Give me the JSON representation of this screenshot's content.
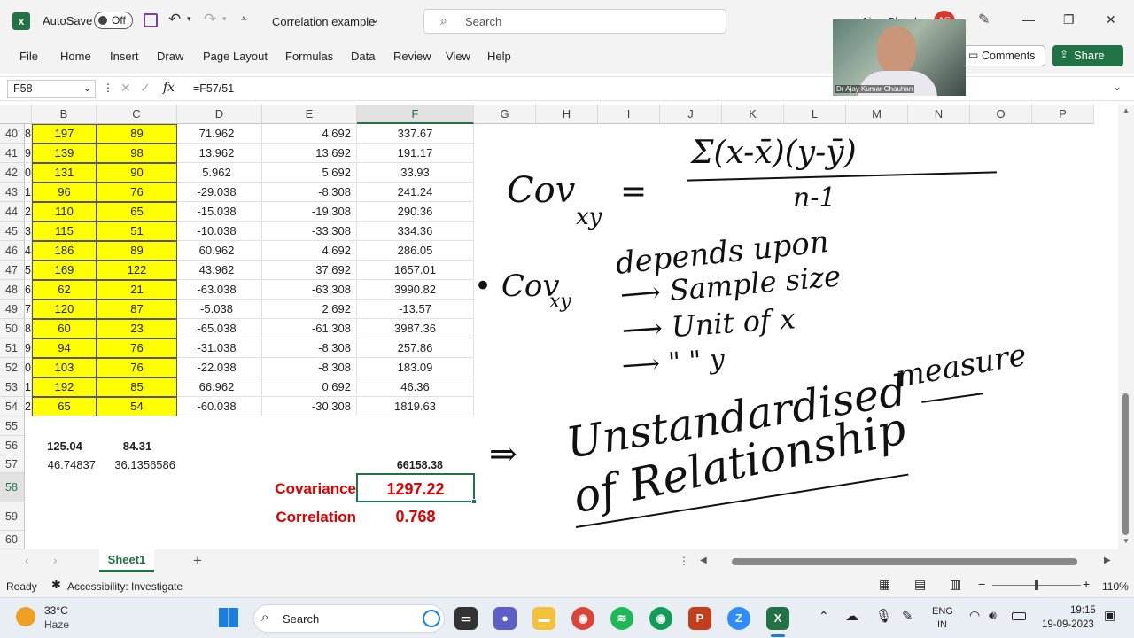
{
  "titlebar": {
    "autosave": "AutoSave",
    "toggle": "Off",
    "doc_title": "Correlation example",
    "search": "Search",
    "user": "Ajay Chauhan",
    "initials": "AC"
  },
  "menu": [
    "File",
    "Home",
    "Insert",
    "Draw",
    "Page Layout",
    "Formulas",
    "Data",
    "Review",
    "View",
    "Help"
  ],
  "buttons": {
    "comments": "Comments",
    "share": "Share"
  },
  "formula_bar": {
    "name_box": "F58",
    "fx": "fx",
    "formula": "=F57/51"
  },
  "webcam": {
    "caption": "Dr Ajay Kumar Chauhan"
  },
  "columns": [
    "B",
    "C",
    "D",
    "E",
    "F",
    "G",
    "H",
    "I",
    "J",
    "K",
    "L",
    "M",
    "N",
    "O",
    "P"
  ],
  "rows": [
    {
      "n": "40",
      "a": "8",
      "b": "197",
      "c": "89",
      "d": "71.962",
      "e": "4.692",
      "f": "337.67"
    },
    {
      "n": "41",
      "a": "9",
      "b": "139",
      "c": "98",
      "d": "13.962",
      "e": "13.692",
      "f": "191.17"
    },
    {
      "n": "42",
      "a": "0",
      "b": "131",
      "c": "90",
      "d": "5.962",
      "e": "5.692",
      "f": "33.93"
    },
    {
      "n": "43",
      "a": "1",
      "b": "96",
      "c": "76",
      "d": "-29.038",
      "e": "-8.308",
      "f": "241.24"
    },
    {
      "n": "44",
      "a": "2",
      "b": "110",
      "c": "65",
      "d": "-15.038",
      "e": "-19.308",
      "f": "290.36"
    },
    {
      "n": "45",
      "a": "3",
      "b": "115",
      "c": "51",
      "d": "-10.038",
      "e": "-33.308",
      "f": "334.36"
    },
    {
      "n": "46",
      "a": "4",
      "b": "186",
      "c": "89",
      "d": "60.962",
      "e": "4.692",
      "f": "286.05"
    },
    {
      "n": "47",
      "a": "5",
      "b": "169",
      "c": "122",
      "d": "43.962",
      "e": "37.692",
      "f": "1657.01"
    },
    {
      "n": "48",
      "a": "6",
      "b": "62",
      "c": "21",
      "d": "-63.038",
      "e": "-63.308",
      "f": "3990.82"
    },
    {
      "n": "49",
      "a": "7",
      "b": "120",
      "c": "87",
      "d": "-5.038",
      "e": "2.692",
      "f": "-13.57"
    },
    {
      "n": "50",
      "a": "8",
      "b": "60",
      "c": "23",
      "d": "-65.038",
      "e": "-61.308",
      "f": "3987.36"
    },
    {
      "n": "51",
      "a": "9",
      "b": "94",
      "c": "76",
      "d": "-31.038",
      "e": "-8.308",
      "f": "257.86"
    },
    {
      "n": "52",
      "a": "0",
      "b": "103",
      "c": "76",
      "d": "-22.038",
      "e": "-8.308",
      "f": "183.09"
    },
    {
      "n": "53",
      "a": "1",
      "b": "192",
      "c": "85",
      "d": "66.962",
      "e": "0.692",
      "f": "46.36"
    },
    {
      "n": "54",
      "a": "2",
      "b": "65",
      "c": "54",
      "d": "-60.038",
      "e": "-30.308",
      "f": "1819.63"
    }
  ],
  "extra_rows": {
    "r55": "55",
    "r56": "56",
    "r57": "57",
    "r58": "58",
    "r59": "59",
    "r60": "60"
  },
  "summary": {
    "mean_b": "125.04",
    "mean_c": "84.31",
    "sd_b": "46.74837",
    "sd_c": "36.1356586",
    "sum_f": "66158.38",
    "cov_label": "Covariance",
    "cov_value": "1297.22",
    "corr_label": "Correlation",
    "corr_value": "0.768"
  },
  "sheet_tab": "Sheet1",
  "status": {
    "ready": "Ready",
    "accessibility": "Accessibility: Investigate",
    "zoom": "110%"
  },
  "taskbar": {
    "weather_temp": "33°C",
    "weather_desc": "Haze",
    "search": "Search",
    "lang1": "ENG",
    "lang2": "IN",
    "time": "19:15",
    "date": "19-09-2023"
  },
  "annotations": {
    "cov_label": "Cov",
    "cov_sub": "xy",
    "formula_num": "Σ(x-x̄)(y-ȳ)",
    "formula_den": "n-1",
    "line1": "• Cov",
    "line1_sub": "xy",
    "line1_rest": "depends upon",
    "line2": "⟶ Sample size",
    "line3": "⟶ Unit of x",
    "line4": "⟶  \"   \"  y",
    "measure": "measure",
    "arrow": "⇒",
    "unstd": "Unstandardised",
    "rel": "of Relationship"
  },
  "colors": {
    "excel_green": "#217346",
    "yellow": "#ffff00",
    "red": "#e00000"
  }
}
